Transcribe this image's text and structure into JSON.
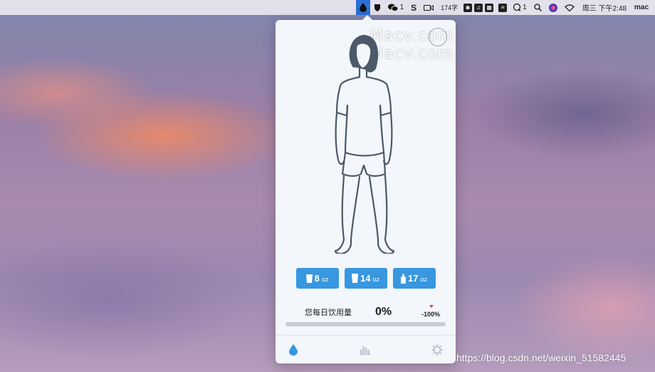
{
  "menubar": {
    "wechat_count": "1",
    "s_label": "S",
    "input_count": "174字",
    "chat_count": "1",
    "clock": "周三 下午2:48",
    "user": "mac"
  },
  "popover": {
    "watermark_lines": [
      "Macv.com",
      "Macv.com"
    ],
    "cups": [
      {
        "value": "8",
        "unit": "oz"
      },
      {
        "value": "14",
        "unit": "oz"
      },
      {
        "value": "17",
        "unit": "oz"
      }
    ],
    "daily_label": "您每日饮用量",
    "percent": "0%",
    "change": "-100%",
    "progress": 0
  },
  "colors": {
    "accent": "#3797e0",
    "change_red": "#e0352b"
  },
  "icons": {
    "tabs": [
      "water-drop-icon",
      "bar-chart-icon",
      "gear-icon"
    ],
    "active_tab": "water-drop-icon"
  },
  "footer_url": "https://blog.csdn.net/weixin_51582445"
}
